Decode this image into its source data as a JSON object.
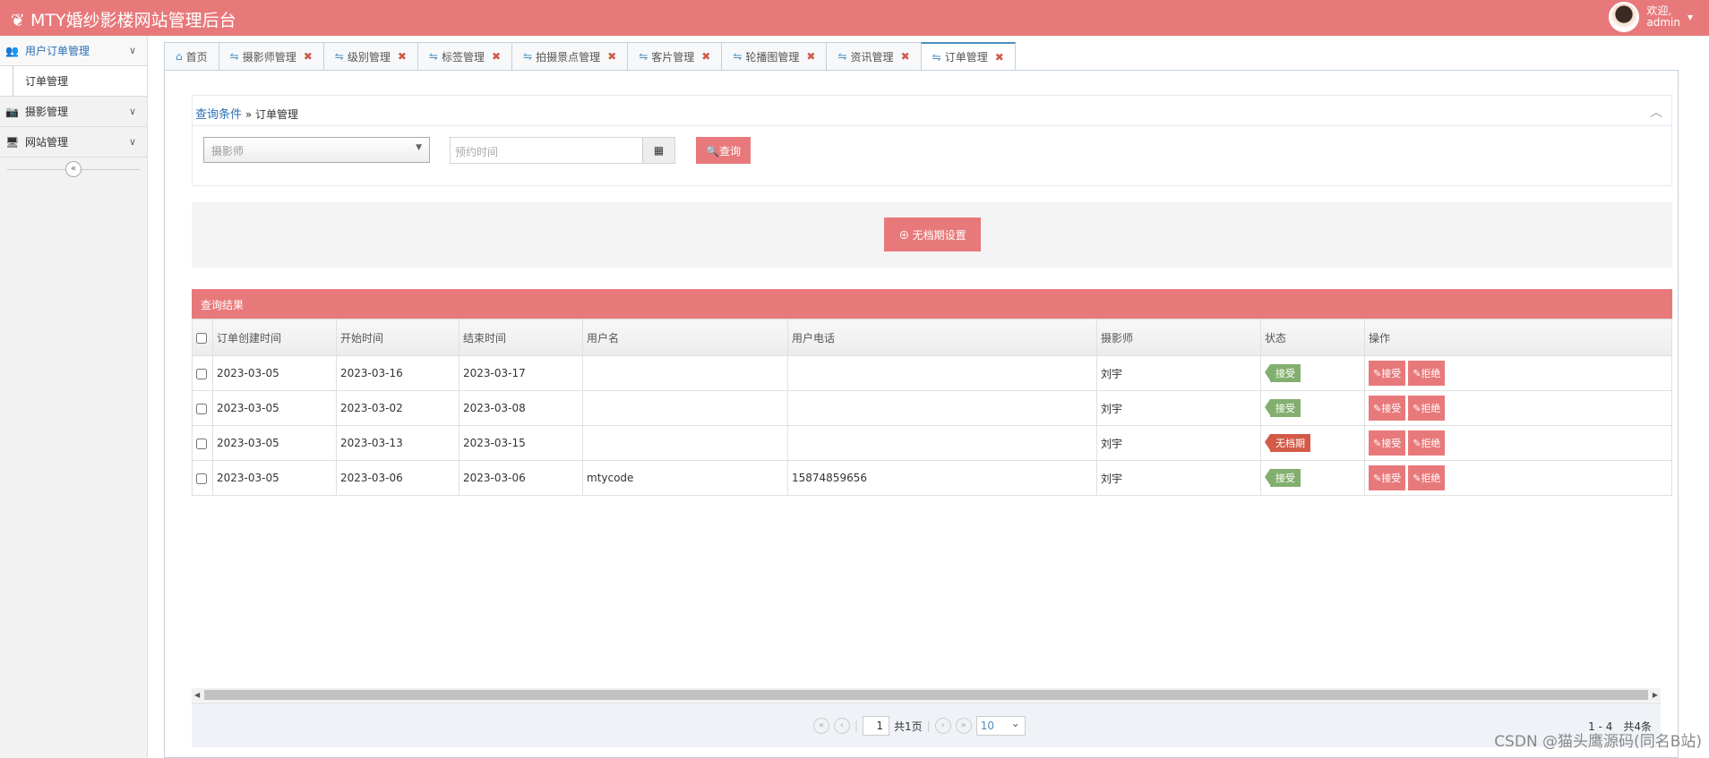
{
  "header": {
    "title": "MTY婚纱影楼网站管理后台",
    "welcome": "欢迎,",
    "user": "admin"
  },
  "sidebar": {
    "items": [
      {
        "label": "用户订单管理",
        "icon": "users-icon",
        "sub": [
          "订单管理"
        ]
      },
      {
        "label": "摄影管理",
        "icon": "camera-icon"
      },
      {
        "label": "网站管理",
        "icon": "desktop-icon"
      }
    ]
  },
  "tabs": [
    "首页",
    "摄影师管理",
    "级别管理",
    "标签管理",
    "拍摄景点管理",
    "客片管理",
    "轮播图管理",
    "资讯管理",
    "订单管理"
  ],
  "query": {
    "title": "查询条件",
    "crumb": "» 订单管理",
    "photographer_placeholder": "摄影师",
    "date_placeholder": "预约时间",
    "search": "查询"
  },
  "action": {
    "label": "无档期设置"
  },
  "results": {
    "title": "查询结果",
    "columns": [
      "订单创建时间",
      "开始时间",
      "结束时间",
      "用户名",
      "用户电话",
      "摄影师",
      "状态",
      "操作"
    ],
    "rows": [
      {
        "created": "2023-03-05",
        "start": "2023-03-16",
        "end": "2023-03-17",
        "user": "",
        "phone": "",
        "photographer": "刘宇",
        "status": "接受",
        "status_color": "#82af6f"
      },
      {
        "created": "2023-03-05",
        "start": "2023-03-02",
        "end": "2023-03-08",
        "user": "",
        "phone": "",
        "photographer": "刘宇",
        "status": "接受",
        "status_color": "#82af6f"
      },
      {
        "created": "2023-03-05",
        "start": "2023-03-13",
        "end": "2023-03-15",
        "user": "",
        "phone": "",
        "photographer": "刘宇",
        "status": "无档期",
        "status_color": "#d15b47"
      },
      {
        "created": "2023-03-05",
        "start": "2023-03-06",
        "end": "2023-03-06",
        "user": "mtycode",
        "phone": "15874859656",
        "photographer": "刘宇",
        "status": "接受",
        "status_color": "#82af6f"
      }
    ],
    "accept": "接受",
    "reject": "拒绝"
  },
  "pager": {
    "page": "1",
    "total_pages": "共1页",
    "page_size": "10",
    "info": "1 - 4　共4条"
  },
  "watermark": "CSDN @猫头鹰源码(同名B站)"
}
